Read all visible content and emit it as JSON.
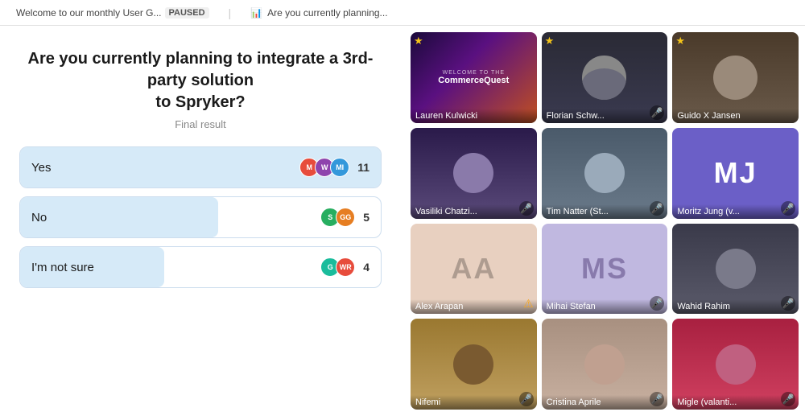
{
  "topbar": {
    "tab1_text": "Welcome to our monthly User G...",
    "tab1_status": "PAUSED",
    "tab2_text": "Are you currently planning..."
  },
  "poll": {
    "question_line1": "Are you currently planning to integrate a 3rd-party solution",
    "question_line2": "to Spryker?",
    "subtitle": "Final result",
    "options": [
      {
        "id": "yes",
        "label": "Yes",
        "votes": 11,
        "bar_width": "100%",
        "avatars": [
          {
            "initials": "M",
            "color": "#e74c3c"
          },
          {
            "initials": "W",
            "color": "#8e44ad"
          },
          {
            "initials": "M",
            "color": "#3498db"
          }
        ]
      },
      {
        "id": "no",
        "label": "No",
        "votes": 5,
        "bar_width": "55%",
        "avatars": [
          {
            "initials": "S",
            "color": "#27ae60"
          },
          {
            "initials": "GG",
            "color": "#e67e22"
          }
        ]
      },
      {
        "id": "not-sure",
        "label": "I'm not sure",
        "votes": 4,
        "bar_width": "40%",
        "avatars": [
          {
            "initials": "G",
            "color": "#1abc9c"
          },
          {
            "initials": "WR",
            "color": "#e74c3c"
          }
        ]
      }
    ]
  },
  "video_grid": {
    "tiles": [
      {
        "id": "lauren",
        "name": "Lauren Kulwicki",
        "type": "banner",
        "star": true,
        "mic": false
      },
      {
        "id": "florian",
        "name": "Florian Schw...",
        "type": "video",
        "star": true,
        "mic": true
      },
      {
        "id": "guido",
        "name": "Guido X Jansen",
        "type": "video",
        "star": true,
        "mic": false
      },
      {
        "id": "vasiliki",
        "name": "Vasiliki Chatzi...",
        "type": "video",
        "star": false,
        "mic": true
      },
      {
        "id": "tim",
        "name": "Tim Natter (St...",
        "type": "video",
        "star": false,
        "mic": true
      },
      {
        "id": "moritz",
        "name": "Moritz Jung (v...",
        "type": "initials",
        "initials": "MJ",
        "star": false,
        "mic": true
      },
      {
        "id": "alex",
        "name": "Alex Arapan",
        "type": "initials",
        "initials": "AA",
        "star": false,
        "warn": true
      },
      {
        "id": "mihai",
        "name": "Mihai Stefan",
        "type": "initials",
        "initials": "MS",
        "star": false,
        "mic": true
      },
      {
        "id": "wahid",
        "name": "Wahid Rahim",
        "type": "video",
        "star": false,
        "mic": true
      },
      {
        "id": "nifemi",
        "name": "Nifemi",
        "type": "video",
        "star": false,
        "mic": true
      },
      {
        "id": "cristina",
        "name": "Cristina Aprile",
        "type": "video",
        "star": false,
        "mic": true
      },
      {
        "id": "migle",
        "name": "Migle (valanti...",
        "type": "video",
        "star": false,
        "mic": true
      }
    ]
  }
}
